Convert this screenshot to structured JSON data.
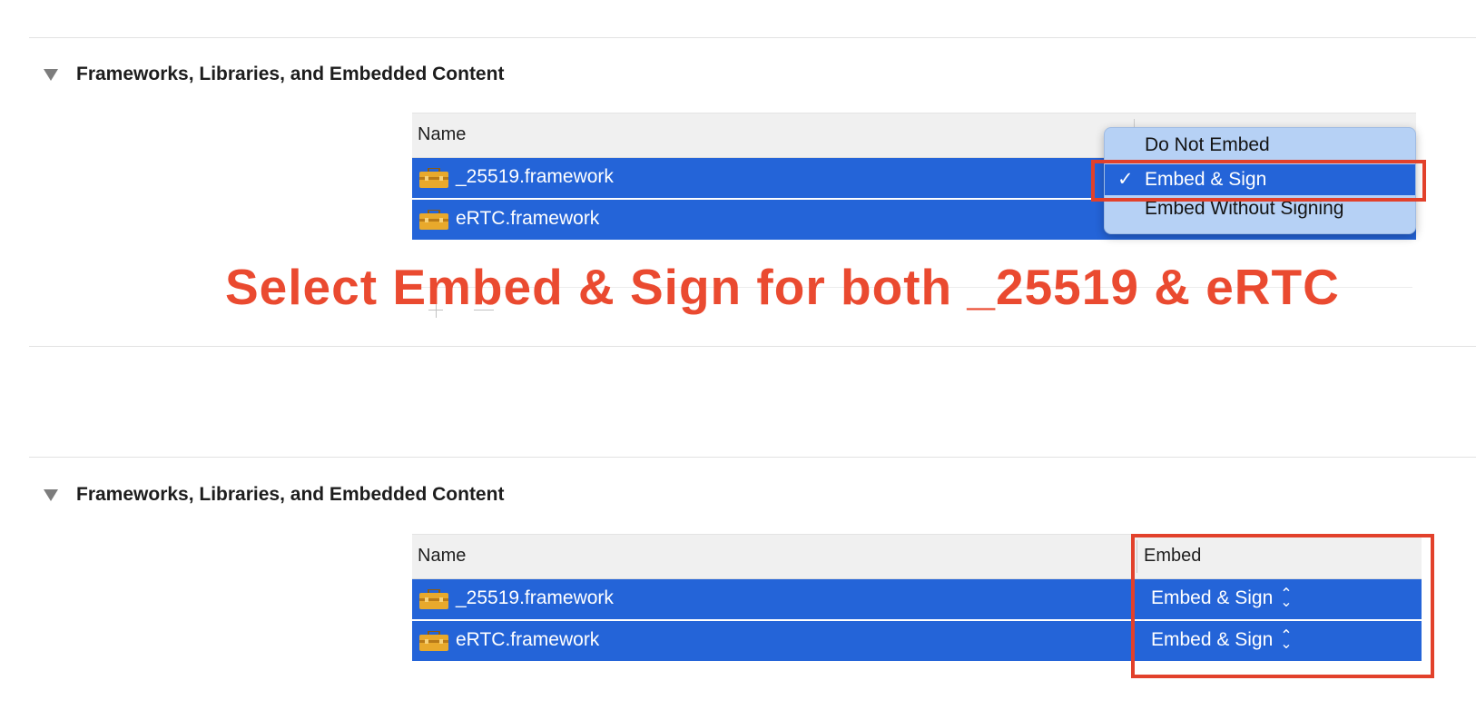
{
  "top_section": {
    "title": "Frameworks, Libraries, and Embedded Content",
    "table": {
      "col_name": "Name",
      "rows": [
        {
          "name": "_25519.framework",
          "icon": "toolbox-icon"
        },
        {
          "name": "eRTC.framework",
          "icon": "toolbox-icon"
        }
      ]
    },
    "dropdown": {
      "options": [
        "Do Not Embed",
        "Embed & Sign",
        "Embed Without Signing"
      ],
      "selected": "Embed & Sign",
      "check": "✓"
    }
  },
  "annotation": "Select Embed & Sign for both _25519 & eRTC",
  "bottom_section": {
    "title": "Frameworks, Libraries, and Embedded Content",
    "table": {
      "col_name": "Name",
      "col_embed": "Embed",
      "rows": [
        {
          "name": "_25519.framework",
          "embed": "Embed & Sign",
          "icon": "toolbox-icon"
        },
        {
          "name": "eRTC.framework",
          "embed": "Embed & Sign",
          "icon": "toolbox-icon"
        }
      ]
    }
  },
  "colors": {
    "selection_blue": "#2464d8",
    "callout_red": "#e2412b",
    "annotation_red": "#ea4a30",
    "menu_bg": "#b6d1f5"
  }
}
